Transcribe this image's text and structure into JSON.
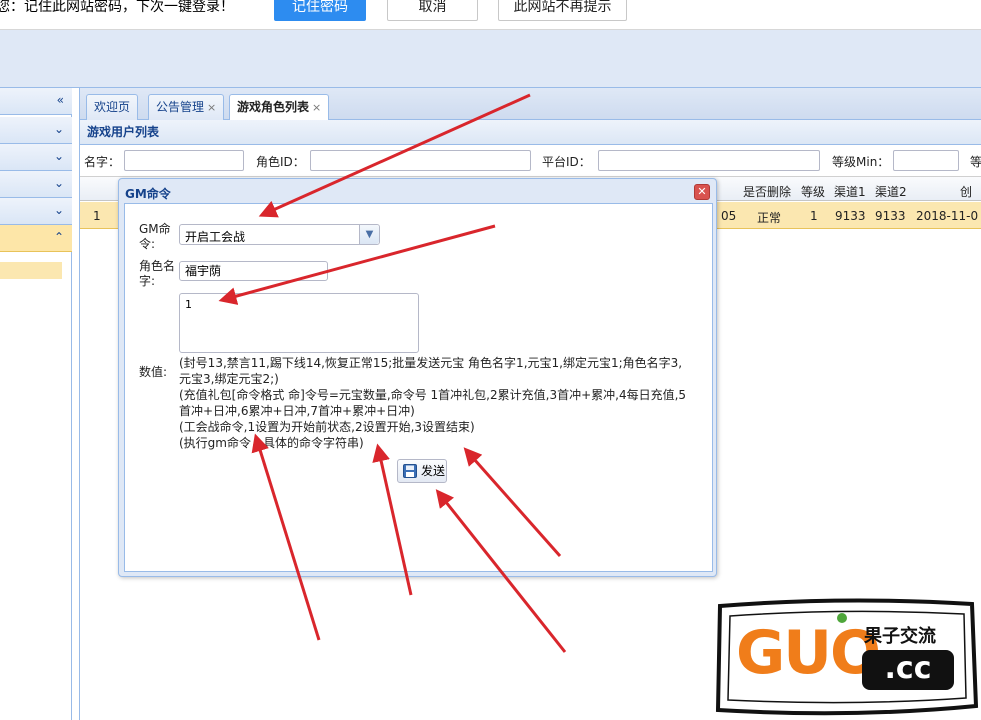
{
  "password_bar": {
    "message": "您：记住此网站密码，下次一键登录！",
    "remember_label": "记住密码",
    "cancel_label": "取消",
    "never_label": "此网站不再提示"
  },
  "tabs": [
    {
      "label": "欢迎页"
    },
    {
      "label": "公告管理"
    },
    {
      "label": "游戏角色列表"
    }
  ],
  "tab_close": "×",
  "panel_title": "游戏用户列表",
  "search": {
    "name_label": "名字：",
    "role_id_label": "角色ID：",
    "platform_id_label": "平台ID：",
    "level_min_label": "等级Min：",
    "trailing_label": "等"
  },
  "grid": {
    "columns": [
      "是否删除",
      "等级",
      "渠道1",
      "渠道2",
      "创建"
    ],
    "row": {
      "index": "1",
      "partial": "05",
      "deleted": "正常",
      "level": "1",
      "channel1": "9133",
      "channel2": "9133",
      "created": "2018-11-0"
    }
  },
  "dialog": {
    "title": "GM命令",
    "close_glyph": "✕",
    "gm_command_label": "GM命\n令:",
    "gm_command_value": "开启工会战",
    "role_name_label": "角色名\n字:",
    "role_name_value": "福宇荫",
    "value_label": "数值:",
    "value_input": "1",
    "hint_lines": [
      "(封号13,禁言11,踢下线14,恢复正常15;批量发送元宝 角色名字1,元宝1,绑定元宝1;角色名字3,",
      "元宝3,绑定元宝2;)",
      "(充值礼包[命令格式 命]令号=元宝数量,命令号 1首冲礼包,2累计充值,3首冲+累冲,4每日充值,5",
      "首冲+日冲,6累冲+日冲,7首冲+累冲+日冲)",
      "(工会战命令,1设置为开始前状态,2设置开始,3设置结束)",
      "(执行gm命令，具体的命令字符串)"
    ],
    "send_label": "发送"
  },
  "watermark": {
    "big": "GUO",
    "small": ".cc",
    "tagline": "果子交流"
  },
  "colors": {
    "accent_blue": "#2d8cf0",
    "panel_border": "#99bbe8",
    "highlight_row": "#fbe7b0",
    "arrow_red": "#d9262c",
    "watermark_orange": "#f07d1a"
  }
}
